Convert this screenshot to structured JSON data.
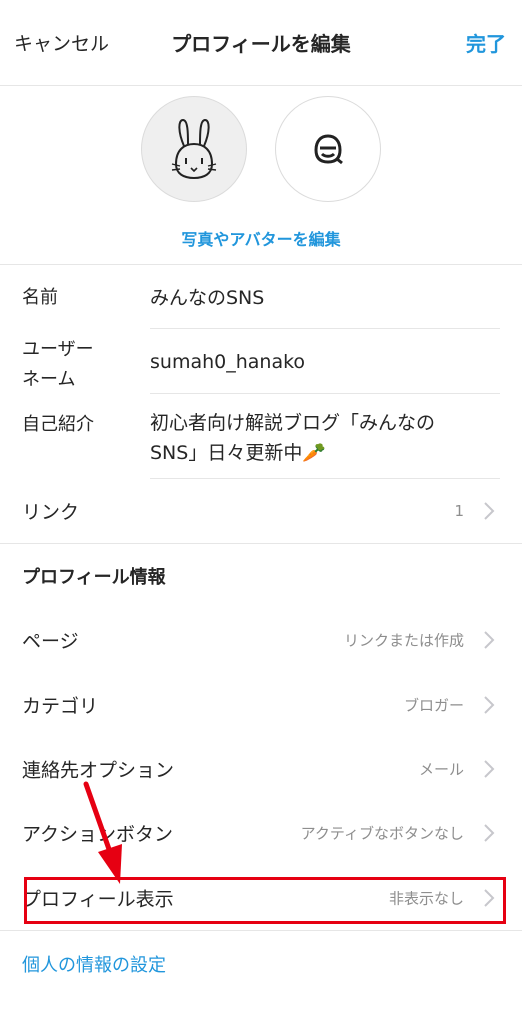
{
  "header": {
    "cancel_label": "キャンセル",
    "title": "プロフィールを編集",
    "done_label": "完了"
  },
  "avatar": {
    "edit_label": "写真やアバターを編集"
  },
  "fields": {
    "name": {
      "label": "名前",
      "value": "みんなのSNS"
    },
    "username": {
      "label_line1": "ユーザー",
      "label_line2": "ネーム",
      "value": "sumah0_hanako"
    },
    "bio": {
      "label": "自己紹介",
      "value_line1": "初心者向け解説ブログ「みんなの",
      "value_line2": "SNS」日々更新中🥕"
    },
    "links": {
      "label": "リンク",
      "value": "1"
    }
  },
  "profile_info": {
    "title": "プロフィール情報",
    "rows": [
      {
        "label": "ページ",
        "value": "リンクまたは作成"
      },
      {
        "label": "カテゴリ",
        "value": "ブロガー"
      },
      {
        "label": "連絡先オプション",
        "value": "メール"
      },
      {
        "label": "アクションボタン",
        "value": "アクティブなボタンなし"
      },
      {
        "label": "プロフィール表示",
        "value": "非表示なし"
      }
    ]
  },
  "privacy_link": "個人の情報の設定",
  "colors": {
    "accent": "#2196dc",
    "highlight": "#e60012",
    "text": "#262626",
    "secondary_text": "#8e8e8e",
    "divider": "#e6e6e6"
  }
}
